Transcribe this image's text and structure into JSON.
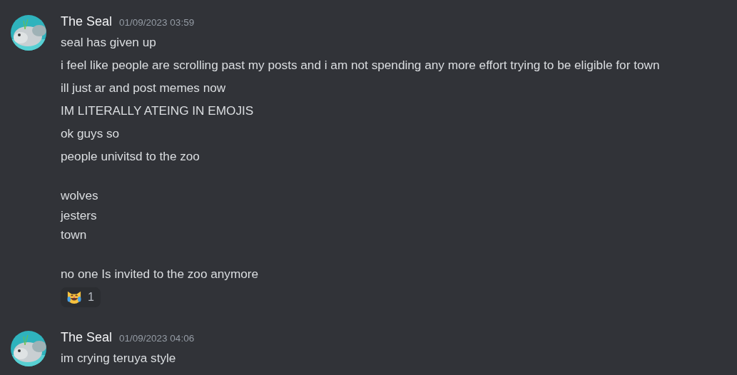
{
  "groups": [
    {
      "author": "The Seal",
      "timestamp": "01/09/2023 03:59",
      "messages": [
        "seal has given up",
        "i feel like people are scrolling past my posts and i am not spending any more effort trying to be eligible for town",
        "ill just ar and post memes now",
        "IM LITERALLY ATEING IN EMOJIS",
        "ok guys so",
        "people univitsd to the zoo\n\nwolves\njesters\ntown\n\nno one Is invited to the zoo anymore"
      ],
      "reactions": [
        {
          "count": "1"
        }
      ]
    },
    {
      "author": "The Seal",
      "timestamp": "01/09/2023 04:06",
      "messages": [
        "im crying teruya style"
      ]
    }
  ]
}
